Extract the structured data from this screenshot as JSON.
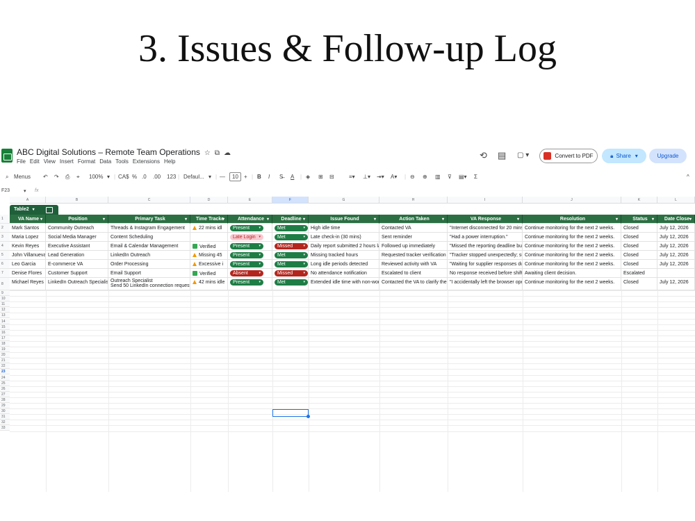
{
  "slide": {
    "title": "3. Issues & Follow-up Log"
  },
  "app": {
    "doc_title": "ABC Digital Solutions – Remote Team Operations",
    "title_icons": [
      "☆",
      "⧉",
      "☁"
    ],
    "menu": [
      "File",
      "Edit",
      "View",
      "Insert",
      "Format",
      "Data",
      "Tools",
      "Extensions",
      "Help"
    ],
    "history_icon": "⟲",
    "comment_icon": "▤",
    "meet_icon": "▢ ▾",
    "convert_pdf": "Convert to PDF",
    "share": "Share",
    "share_caret": "▾",
    "upgrade": "Upgrade",
    "expand_icon": "^"
  },
  "toolbar": {
    "search": "Menus",
    "undo": "↶",
    "redo": "↷",
    "print": "⎙",
    "paint": "⌖",
    "zoom": "100%",
    "zoom_caret": "▾",
    "currency": "CA$",
    "percent": "%",
    "dec_dec": ".0",
    "dec_inc": ".00",
    "num_format": "123",
    "font": "Defaul...",
    "font_caret": "▾",
    "minus": "—",
    "font_size": "10",
    "plus": "+",
    "bold": "B",
    "italic": "I",
    "strike": "S̶",
    "text_color": "A",
    "fill": "◈",
    "borders": "⊞",
    "merge": "⊟",
    "halign": "≡▾",
    "valign": "⊥▾",
    "wrap": "⇥▾",
    "rotate": "A▾",
    "link": "⊖",
    "comment": "⊕",
    "chart": "▥",
    "filter": "⊽",
    "views": "▤▾",
    "functions": "Σ"
  },
  "formula_bar": {
    "cell_ref": "F23",
    "caret": "▾",
    "fx": "fx"
  },
  "sheet": {
    "column_letters": [
      "A",
      "B",
      "C",
      "D",
      "E",
      "F",
      "G",
      "H",
      "I",
      "J",
      "K",
      "L"
    ],
    "selected_column": "F",
    "table_name": "Table2",
    "table_caret": "▾",
    "headers": [
      "VA Name",
      "Position",
      "Primary Task",
      "Time Tracke",
      "Attendance",
      "Deadline",
      "Issue Found",
      "Action Taken",
      "VA Response",
      "Resolution",
      "Status",
      "Date Close"
    ],
    "caret": "▾",
    "rows": [
      {
        "va": "Mark Santos",
        "position": "Community Outreach",
        "task": "Threads & Instagram Engagement",
        "task2": "",
        "time": "22 mins idl",
        "time_kind": "warn",
        "attendance": "Present",
        "att_kind": "green",
        "deadline": "Met",
        "dl_kind": "green",
        "issue": "High idle time",
        "action": "Contacted VA",
        "response": "\"Internet disconnected for 20 mins",
        "resolution": "Continue monitoring for the next 2 weeks.",
        "status": "Closed",
        "date": "July 12, 2026"
      },
      {
        "va": "Maria Lopez",
        "position": "Social Media Manager",
        "task": "Content Scheduling",
        "task2": "",
        "time": "",
        "time_kind": "none",
        "attendance": "Late Login",
        "att_kind": "pink",
        "deadline": "Met",
        "dl_kind": "green",
        "issue": "Late check-in (30 mins)",
        "action": "Sent reminder",
        "response": "\"Had a power interruption.\"",
        "resolution": "Continue monitoring for the next 2 weeks.",
        "status": "Closed",
        "date": "July 12, 2026"
      },
      {
        "va": "Kevin Reyes",
        "position": "Executive Assistant",
        "task": "Email & Calendar Management",
        "task2": "",
        "time": "Verified",
        "time_kind": "check",
        "attendance": "Present",
        "att_kind": "green",
        "deadline": "Missed",
        "dl_kind": "red",
        "issue": "Daily report submitted 2 hours la",
        "action": "Followed up immediately",
        "response": "\"Missed the reporting deadline but",
        "resolution": "Continue monitoring for the next 2 weeks.",
        "status": "Closed",
        "date": "July 12, 2026"
      },
      {
        "va": "John Villanueva",
        "position": "Lead Generation",
        "task": "LinkedIn Outreach",
        "task2": "",
        "time": "Missing 45",
        "time_kind": "warn",
        "attendance": "Present",
        "att_kind": "green",
        "deadline": "Met",
        "dl_kind": "green",
        "issue": "Missing tracked hours",
        "action": "Requested tracker verification",
        "response": "\"Tracker stopped unexpectedly; su",
        "resolution": "Continue monitoring for the next 2 weeks.",
        "status": "Closed",
        "date": "July 12, 2026"
      },
      {
        "va": "Leo Garcia",
        "position": "E-commerce VA",
        "task": "Order Processing",
        "task2": "",
        "time": "Excessive i",
        "time_kind": "warn",
        "attendance": "Present",
        "att_kind": "green",
        "deadline": "Met",
        "dl_kind": "green",
        "issue": "Long idle periods detected",
        "action": "Reviewed activity with VA",
        "response": "\"Waiting for supplier responses du",
        "resolution": "Continue monitoring for the next 2 weeks.",
        "status": "Closed",
        "date": "July 12, 2026"
      },
      {
        "va": "Denise Flores",
        "position": "Customer Support",
        "task": "Email Support",
        "task2": "",
        "time": "Verified",
        "time_kind": "check",
        "attendance": "Absent",
        "att_kind": "red",
        "deadline": "Missed",
        "dl_kind": "red",
        "issue": "No attendance notification",
        "action": "Escalated to client",
        "response": "No response received before shift",
        "resolution": "Awaiting client decision.",
        "status": "Escalated",
        "date": ""
      },
      {
        "va": "Michael Reyes",
        "position": "LinkedIn Outreach Specialist",
        "task": "Outreach Specialist",
        "task2": "Send 50 LinkedIn connection request",
        "time": "42 mins idle",
        "time_kind": "warn",
        "attendance": "Present",
        "att_kind": "green",
        "deadline": "Met",
        "dl_kind": "green",
        "issue": "Extended idle time with non-wor",
        "action": "Contacted the VA to clarify the",
        "response": "\"I accidentally left the browser ope",
        "resolution": "Continue monitoring for the next 2 weeks.",
        "status": "Closed",
        "date": "July 12, 2026"
      }
    ],
    "row_numbers": [
      "1",
      "2",
      "3",
      "4",
      "5",
      "6",
      "7",
      "8",
      "9",
      "10",
      "11",
      "12",
      "13",
      "14",
      "15",
      "16",
      "17",
      "18",
      "19",
      "20",
      "21",
      "22",
      "23",
      "24",
      "25",
      "26",
      "27",
      "28",
      "29",
      "30",
      "31",
      "32",
      "33"
    ],
    "selected_row": "23"
  },
  "colors": {
    "header_green": "#2b6f43",
    "chip_green": "#1e7d45",
    "chip_red": "#b3261e",
    "chip_pink": "#f9c9d1",
    "selection_blue": "#1a73e8"
  }
}
